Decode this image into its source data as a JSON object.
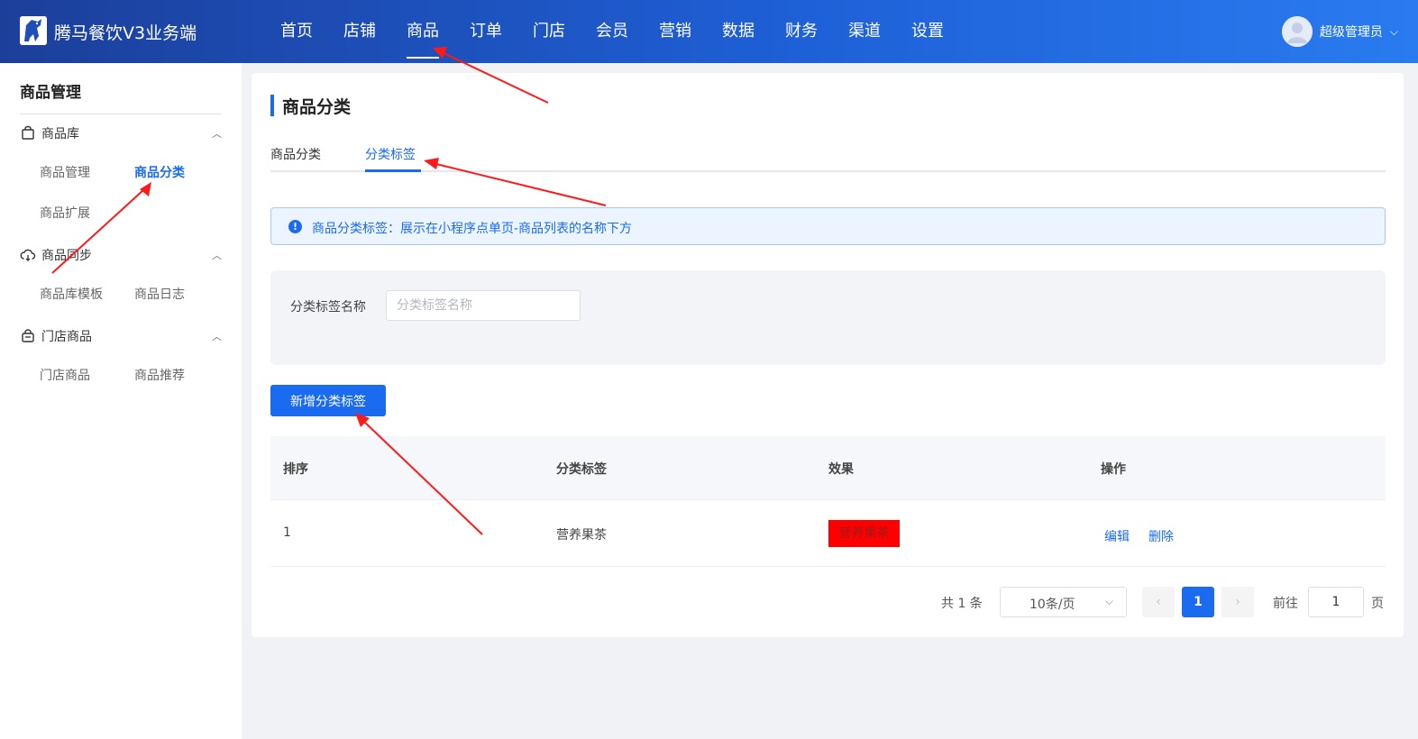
{
  "header": {
    "brand": "腾马餐饮V3业务端",
    "nav": [
      "首页",
      "店铺",
      "商品",
      "订单",
      "门店",
      "会员",
      "营销",
      "数据",
      "财务",
      "渠道",
      "设置"
    ],
    "active_nav": "商品",
    "user_name": "超级管理员"
  },
  "sidebar": {
    "title": "商品管理",
    "groups": [
      {
        "label": "商品库",
        "icon": "bag-icon",
        "items": [
          "商品管理",
          "商品分类",
          "商品扩展"
        ]
      },
      {
        "label": "商品同步",
        "icon": "cloud-sync-icon",
        "items": [
          "商品库模板",
          "商品日志"
        ]
      },
      {
        "label": "门店商品",
        "icon": "shop-bag-icon",
        "items": [
          "门店商品",
          "商品推荐"
        ]
      }
    ],
    "active_item": "商品分类"
  },
  "main": {
    "page_title": "商品分类",
    "tabs": [
      "商品分类",
      "分类标签"
    ],
    "active_tab": "分类标签",
    "alert": "商品分类标签：展示在小程序点单页-商品列表的名称下方",
    "filter": {
      "label": "分类标签名称",
      "placeholder": "分类标签名称",
      "value": ""
    },
    "add_button": "新增分类标签",
    "table": {
      "headers": [
        "排序",
        "分类标签",
        "效果",
        "操作"
      ],
      "rows": [
        {
          "order": "1",
          "tag": "营养果茶",
          "effect": "营养果茶",
          "effect_bg": "#ff0000",
          "actions": [
            "编辑",
            "删除"
          ]
        }
      ]
    },
    "pagination": {
      "total": "共 1 条",
      "page_size": "10条/页",
      "prev": "‹",
      "current": "1",
      "next": "›",
      "goto_label": "前往",
      "goto_value": "1",
      "goto_unit": "页"
    }
  },
  "colors": {
    "accent": "#1a6bf0",
    "header_start": "#1c3f9a",
    "header_end": "#2a7bf0",
    "annotation_arrow": "#ff1a1a"
  }
}
